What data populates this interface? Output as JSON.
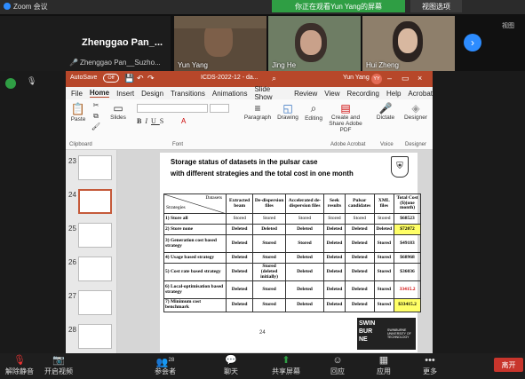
{
  "zoom": {
    "app_title": "Zoom 会议",
    "share_banner": "你正在观看Yun Yang的屏幕",
    "view_options": "视图选项",
    "side_view_label": "视图",
    "presenter_name": "Zhenggao Pan_...",
    "participants": [
      {
        "name": "Zhenggao Pan__Suzho..."
      },
      {
        "name": "Yun Yang"
      },
      {
        "name": "Jing He"
      },
      {
        "name": "Hui Zheng"
      }
    ],
    "bottom_bar": {
      "unmute": "解除静音",
      "start_video": "开启视频",
      "participants": "参会者",
      "participant_count": "28",
      "chat": "聊天",
      "share_screen": "共享屏幕",
      "reactions": "回应",
      "apps": "应用",
      "more": "更多",
      "leave": "离开"
    }
  },
  "ppt": {
    "autosave": "AutoSave",
    "autosave_state": "Off",
    "file_name": "ICDS-2022-12 - da...",
    "user": "Yun Yang",
    "user_initials": "YY",
    "menu": [
      "File",
      "Home",
      "Insert",
      "Design",
      "Transitions",
      "Animations",
      "Slide Show",
      "Review",
      "View",
      "Recording",
      "Help",
      "Acrobat"
    ],
    "active_tab": "Home",
    "ribbon": {
      "paste": "Paste",
      "slides": "Slides",
      "paragraph": "Paragraph",
      "drawing": "Drawing",
      "editing": "Editing",
      "create_share": "Create and Share Adobe PDF",
      "dictate": "Dictate",
      "designer": "Designer",
      "sections": {
        "clipboard": "Clipboard",
        "font": "Font",
        "adobe": "Adobe Acrobat",
        "voice": "Voice",
        "designer": "Designer"
      }
    },
    "thumbnails": [
      "23",
      "24",
      "25",
      "26",
      "27",
      "28"
    ],
    "active_slide": "24"
  },
  "slide": {
    "title_line1": "Storage status of datasets in the pulsar case",
    "title_line2": "with different strategies and the total cost in one month",
    "header": {
      "datasets": "Datasets",
      "strategies": "Strategies",
      "cols": [
        "Extracted beam",
        "De-dispersion files",
        "Accelerated de-dispersion files",
        "Seek results",
        "Pulsar candidates",
        "XML files",
        "Total Cost ($)(one month)"
      ]
    },
    "rows": [
      {
        "strategy": "1) Store all",
        "cells": [
          "Stored",
          "Stored",
          "Stored",
          "Stored",
          "Stored",
          "Stored"
        ],
        "cost": "$68523"
      },
      {
        "strategy": "2) Store none",
        "cells": [
          "Deleted",
          "Deleted",
          "Deleted",
          "Deleted",
          "Deleted",
          "Deleted"
        ],
        "cost": "$72072"
      },
      {
        "strategy": "3) Generation cost based strategy",
        "cells": [
          "Deleted",
          "Stored",
          "Stored",
          "Deleted",
          "Deleted",
          "Stored"
        ],
        "cost": "$49183"
      },
      {
        "strategy": "4) Usage based strategy",
        "cells": [
          "Deleted",
          "Stored",
          "Deleted",
          "Deleted",
          "Deleted",
          "Stored"
        ],
        "cost": "$68968"
      },
      {
        "strategy": "5) Cost rate based strategy",
        "cells": [
          "Deleted",
          "Stored (deleted initially)",
          "Deleted",
          "Deleted",
          "Deleted",
          "Stored"
        ],
        "cost": "$36036"
      },
      {
        "strategy": "6) Local-optimisation based strategy",
        "cells": [
          "Deleted",
          "Stored",
          "Deleted",
          "Deleted",
          "Deleted",
          "Stored"
        ],
        "cost": "33415.2"
      },
      {
        "strategy": "7) Minimum cost benchmark",
        "cells": [
          "Deleted",
          "Stored",
          "Deleted",
          "Deleted",
          "Deleted",
          "Stored"
        ],
        "cost": "$33415.2"
      }
    ],
    "page_number": "24",
    "logo_text": [
      "SWIN",
      "BUR",
      "NE"
    ],
    "logo_subtext": "SWINBURNE UNIVERSITY OF TECHNOLOGY"
  }
}
